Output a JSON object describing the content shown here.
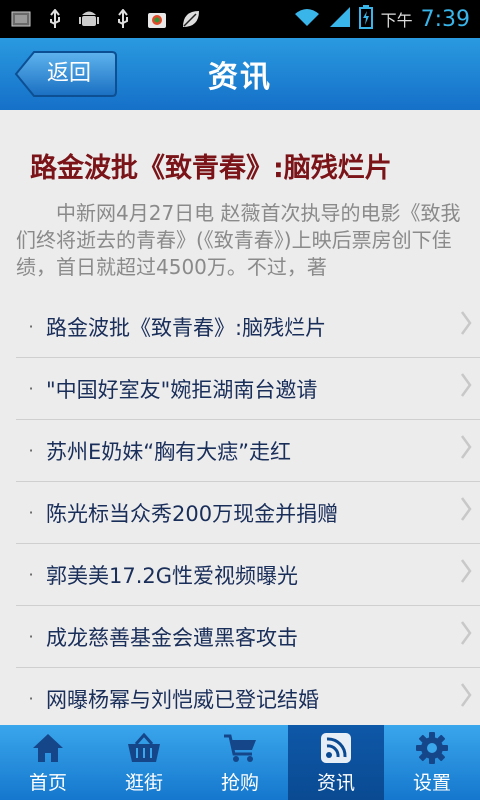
{
  "status_bar": {
    "ampm": "下午",
    "time": "7:39",
    "accent_color": "#39b5ea"
  },
  "header": {
    "back_label": "返回",
    "title": "资讯"
  },
  "article": {
    "title": "路金波批《致青春》:脑残烂片",
    "summary": "中新网4月27日电 赵薇首次执导的电影《致我们终将逝去的青春》(《致青春》)上映后票房创下佳绩，首日就超过4500万。不过，著"
  },
  "news_list": [
    {
      "title": "路金波批《致青春》:脑残烂片"
    },
    {
      "title": "\"中国好室友\"婉拒湖南台邀请"
    },
    {
      "title": "苏州E奶妹“胸有大痣”走红"
    },
    {
      "title": "陈光标当众秀200万现金并捐赠"
    },
    {
      "title": "郭美美17.2G性爱视频曝光"
    },
    {
      "title": "成龙慈善基金会遭黑客攻击"
    },
    {
      "title": "网曝杨幂与刘恺威已登记结婚"
    }
  ],
  "tabs": [
    {
      "label": "首页",
      "icon": "home-icon"
    },
    {
      "label": "逛街",
      "icon": "basket-icon"
    },
    {
      "label": "抢购",
      "icon": "cart-icon"
    },
    {
      "label": "资讯",
      "icon": "rss-icon",
      "active": true
    },
    {
      "label": "设置",
      "icon": "gear-icon"
    }
  ],
  "colors": {
    "header_blue": "#1f86d8",
    "article_title": "#7a1418",
    "list_text": "#1a2e5a",
    "active_tab": "#0a4a92"
  }
}
